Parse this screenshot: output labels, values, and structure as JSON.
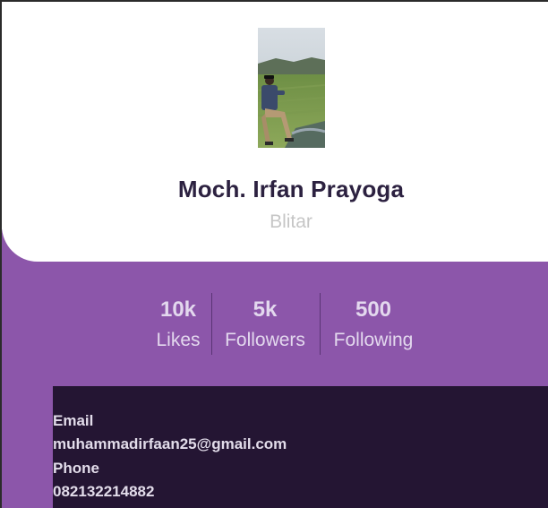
{
  "profile": {
    "name": "Moch. Irfan Prayoga",
    "city": "Blitar",
    "photo_icon": "profile-photo"
  },
  "stats": [
    {
      "value": "10k",
      "label": "Likes"
    },
    {
      "value": "5k",
      "label": "Followers"
    },
    {
      "value": "500",
      "label": "Following"
    }
  ],
  "contact": {
    "email_label": "Email",
    "email_value": "muhammadirfaan25@gmail.com",
    "phone_label": "Phone",
    "phone_value": "082132214882"
  },
  "colors": {
    "accent_purple": "#8c56aa",
    "dark_panel": "#241533",
    "name_text": "#2c2140",
    "city_text": "#c6c6c6"
  }
}
